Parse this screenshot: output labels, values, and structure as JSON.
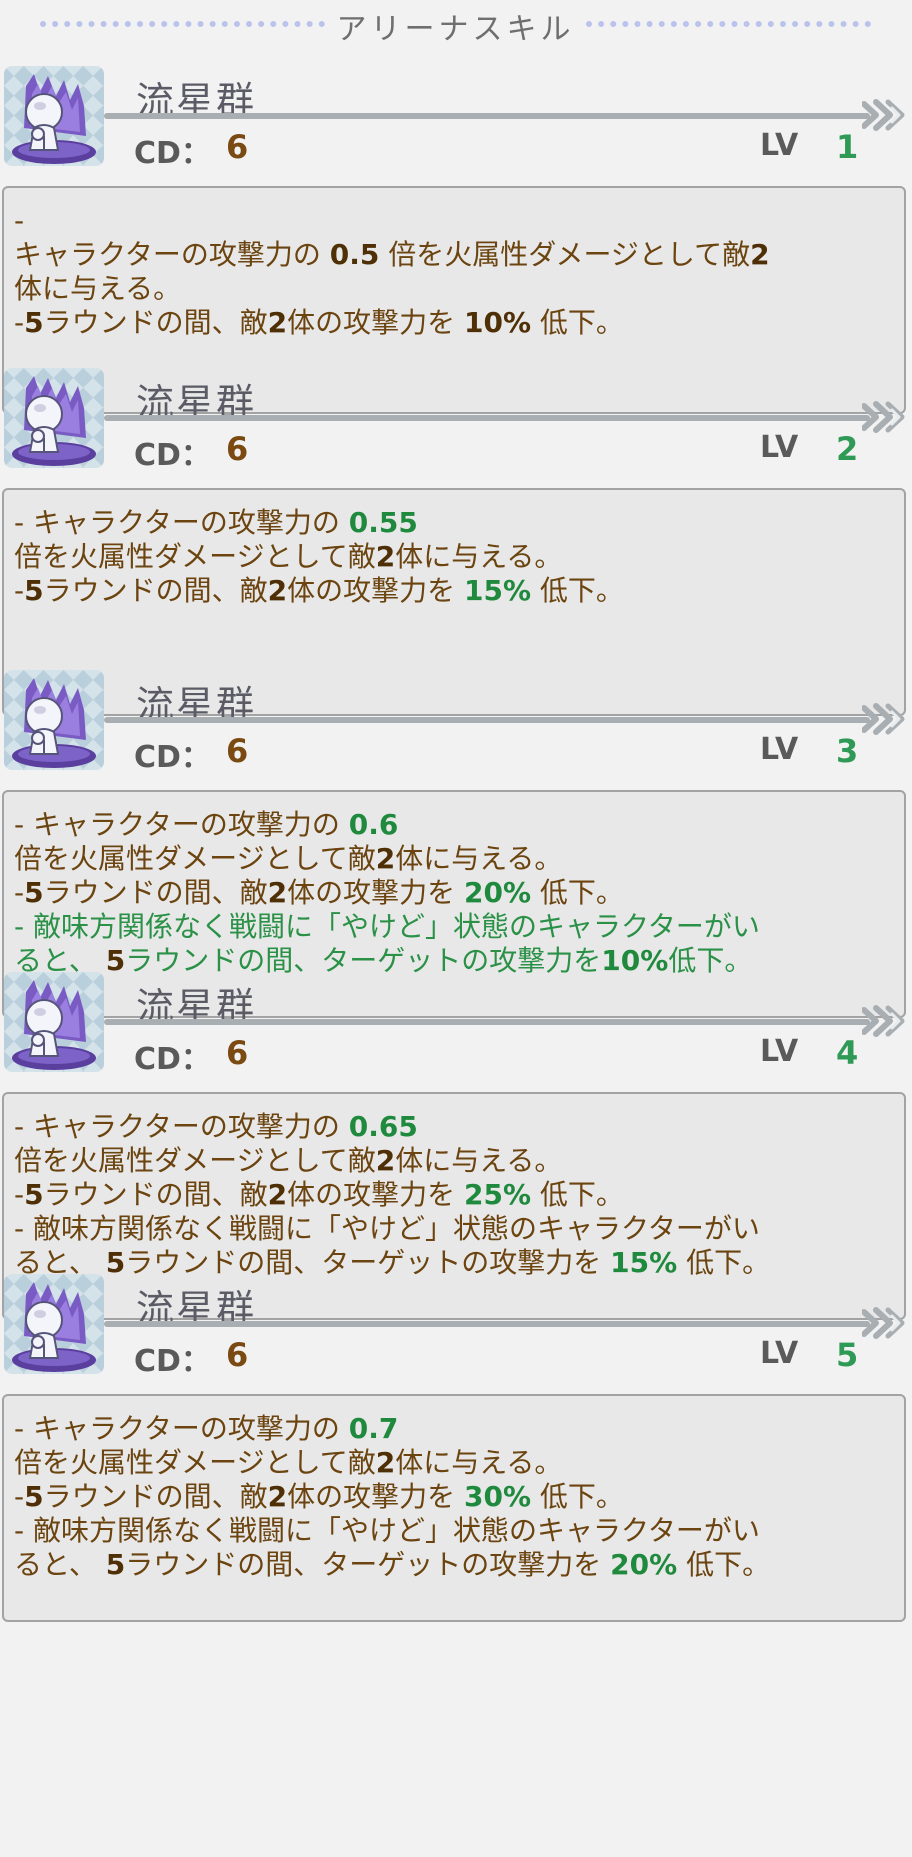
{
  "header": {
    "title": "アリーナスキル"
  },
  "colors": {
    "accent_green": "#2f9a55",
    "text_brown": "#6b4410",
    "divider": "#a8aeb1"
  },
  "skills": [
    {
      "name": "流星群",
      "cd_label": "CD：",
      "cd": "6",
      "lv_label": "LV",
      "lv": "1",
      "icon": "meteor-shower-icon",
      "lines": [
        [
          "-"
        ],
        [
          "キャラクターの攻撃力の ",
          "0.5",
          " 倍を火属性ダメージとして敵",
          "2"
        ],
        [
          "体に与える。"
        ],
        [
          "-",
          "5",
          "ラウンドの間、敵",
          "2",
          "体の攻撃力を ",
          "10%",
          " 低下。"
        ]
      ]
    },
    {
      "name": "流星群",
      "cd_label": "CD：",
      "cd": "6",
      "lv_label": "LV",
      "lv": "2",
      "icon": "meteor-shower-icon",
      "lines": [
        [
          "- キャラクターの攻撃力の ",
          "0.55"
        ],
        [
          "倍を火属性ダメージとして敵",
          "2",
          "体に与える。"
        ],
        [
          "-",
          "5",
          "ラウンドの間、敵",
          "2",
          "体の攻撃力を ",
          "15%",
          " 低下。"
        ]
      ]
    },
    {
      "name": "流星群",
      "cd_label": "CD：",
      "cd": "6",
      "lv_label": "LV",
      "lv": "3",
      "icon": "meteor-shower-icon",
      "lines": [
        [
          "- キャラクターの攻撃力の ",
          "0.6"
        ],
        [
          "倍を火属性ダメージとして敵",
          "2",
          "体に与える。"
        ],
        [
          "-",
          "5",
          "ラウンドの間、敵",
          "2",
          "体の攻撃力を ",
          "20%",
          " 低下。"
        ],
        [
          "- 敵味方関係なく戦闘に「やけど」状態のキャラクターがい"
        ],
        [
          "ると、 ",
          "5",
          "ラウンドの間、ターゲットの攻撃力を",
          "10%",
          "低下。"
        ]
      ]
    },
    {
      "name": "流星群",
      "cd_label": "CD：",
      "cd": "6",
      "lv_label": "LV",
      "lv": "4",
      "icon": "meteor-shower-icon",
      "lines": [
        [
          "- キャラクターの攻撃力の ",
          "0.65"
        ],
        [
          "倍を火属性ダメージとして敵",
          "2",
          "体に与える。"
        ],
        [
          "-",
          "5",
          "ラウンドの間、敵",
          "2",
          "体の攻撃力を ",
          "25%",
          " 低下。"
        ],
        [
          "- 敵味方関係なく戦闘に「やけど」状態のキャラクターがい"
        ],
        [
          "ると、 ",
          "5",
          "ラウンドの間、ターゲットの攻撃力を ",
          "15%",
          " 低下。"
        ]
      ]
    },
    {
      "name": "流星群",
      "cd_label": "CD：",
      "cd": "6",
      "lv_label": "LV",
      "lv": "5",
      "icon": "meteor-shower-icon",
      "lines": [
        [
          "- キャラクターの攻撃力の ",
          "0.7"
        ],
        [
          "倍を火属性ダメージとして敵",
          "2",
          "体に与える。"
        ],
        [
          "-",
          "5",
          "ラウンドの間、敵",
          "2",
          "体の攻撃力を ",
          "30%",
          " 低下。"
        ],
        [
          "- 敵味方関係なく戦闘に「やけど」状態のキャラクターがい"
        ],
        [
          "ると、 ",
          "5",
          "ラウンドの間、ターゲットの攻撃力を ",
          "20%",
          " 低下。"
        ]
      ]
    }
  ]
}
